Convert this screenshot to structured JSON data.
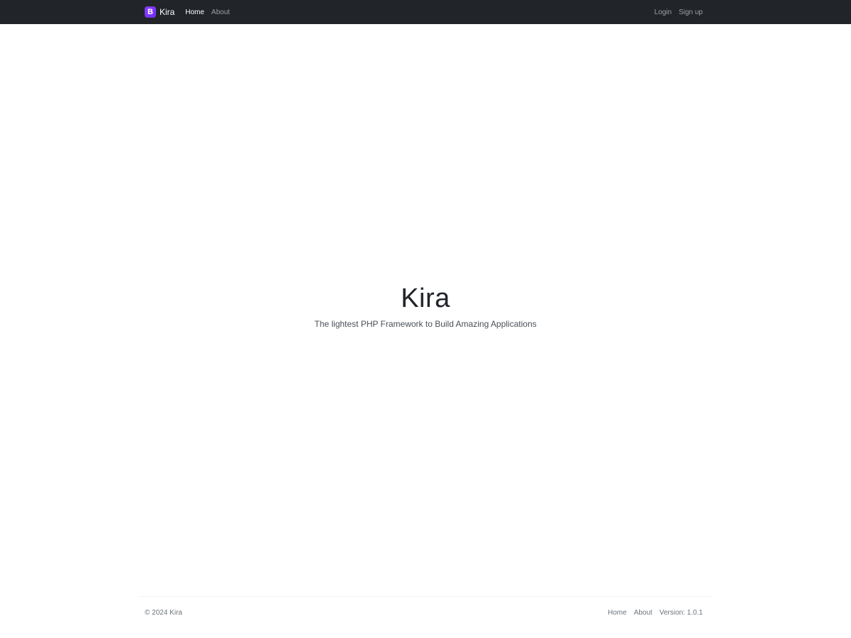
{
  "navbar": {
    "brand_logo_letter": "B",
    "brand_name": "Kira",
    "links": [
      {
        "label": "Home"
      },
      {
        "label": "About"
      }
    ],
    "auth": {
      "login_label": "Login",
      "signup_label": "Sign up"
    }
  },
  "hero": {
    "title": "Kira",
    "subtitle": "The lightest PHP Framework to Build Amazing Applications"
  },
  "footer": {
    "copyright": "© 2024 Kira",
    "links": [
      {
        "label": "Home"
      },
      {
        "label": "About"
      }
    ],
    "version": "Version: 1.0.1"
  },
  "colors": {
    "navbar_bg": "#212529",
    "brand_accent": "#7952b3"
  }
}
